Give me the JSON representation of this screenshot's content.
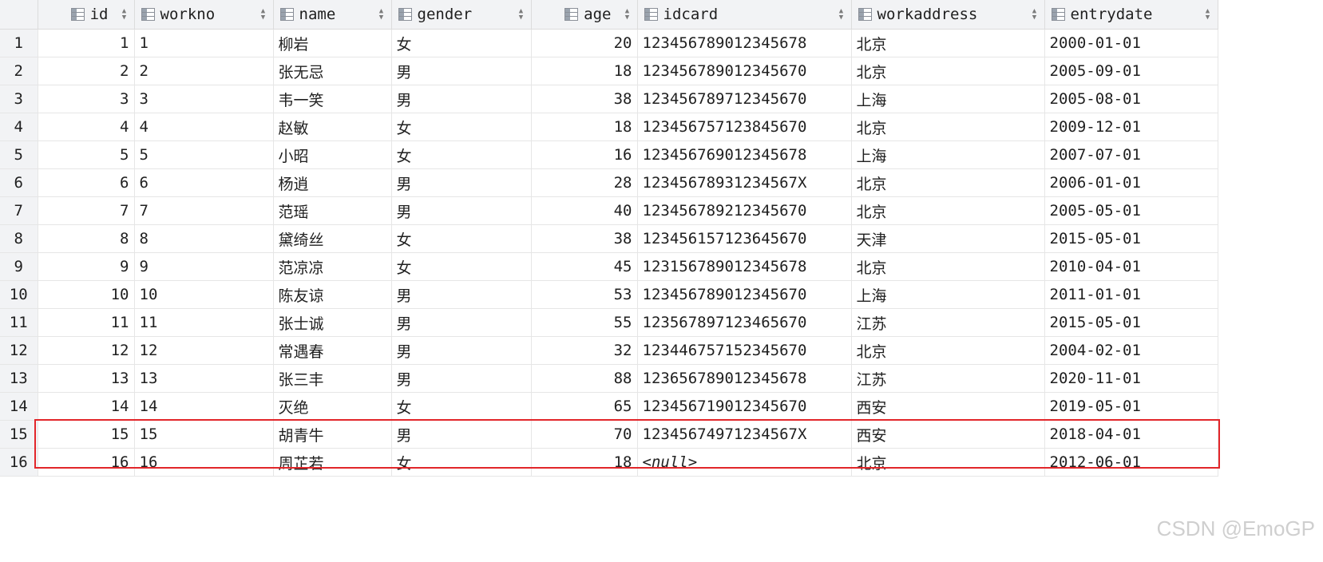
{
  "columns": [
    "id",
    "workno",
    "name",
    "gender",
    "age",
    "idcard",
    "workaddress",
    "entrydate"
  ],
  "rows": [
    {
      "n": "1",
      "id": "1",
      "workno": "1",
      "name": "柳岩",
      "gender": "女",
      "age": "20",
      "idcard": "123456789012345678",
      "workaddress": "北京",
      "entrydate": "2000-01-01"
    },
    {
      "n": "2",
      "id": "2",
      "workno": "2",
      "name": "张无忌",
      "gender": "男",
      "age": "18",
      "idcard": "123456789012345670",
      "workaddress": "北京",
      "entrydate": "2005-09-01"
    },
    {
      "n": "3",
      "id": "3",
      "workno": "3",
      "name": "韦一笑",
      "gender": "男",
      "age": "38",
      "idcard": "123456789712345670",
      "workaddress": "上海",
      "entrydate": "2005-08-01"
    },
    {
      "n": "4",
      "id": "4",
      "workno": "4",
      "name": "赵敏",
      "gender": "女",
      "age": "18",
      "idcard": "123456757123845670",
      "workaddress": "北京",
      "entrydate": "2009-12-01"
    },
    {
      "n": "5",
      "id": "5",
      "workno": "5",
      "name": "小昭",
      "gender": "女",
      "age": "16",
      "idcard": "123456769012345678",
      "workaddress": "上海",
      "entrydate": "2007-07-01"
    },
    {
      "n": "6",
      "id": "6",
      "workno": "6",
      "name": "杨逍",
      "gender": "男",
      "age": "28",
      "idcard": "12345678931234567X",
      "workaddress": "北京",
      "entrydate": "2006-01-01"
    },
    {
      "n": "7",
      "id": "7",
      "workno": "7",
      "name": "范瑶",
      "gender": "男",
      "age": "40",
      "idcard": "123456789212345670",
      "workaddress": "北京",
      "entrydate": "2005-05-01"
    },
    {
      "n": "8",
      "id": "8",
      "workno": "8",
      "name": "黛绮丝",
      "gender": "女",
      "age": "38",
      "idcard": "123456157123645670",
      "workaddress": "天津",
      "entrydate": "2015-05-01"
    },
    {
      "n": "9",
      "id": "9",
      "workno": "9",
      "name": "范凉凉",
      "gender": "女",
      "age": "45",
      "idcard": "123156789012345678",
      "workaddress": "北京",
      "entrydate": "2010-04-01"
    },
    {
      "n": "10",
      "id": "10",
      "workno": "10",
      "name": "陈友谅",
      "gender": "男",
      "age": "53",
      "idcard": "123456789012345670",
      "workaddress": "上海",
      "entrydate": "2011-01-01"
    },
    {
      "n": "11",
      "id": "11",
      "workno": "11",
      "name": "张士诚",
      "gender": "男",
      "age": "55",
      "idcard": "123567897123465670",
      "workaddress": "江苏",
      "entrydate": "2015-05-01"
    },
    {
      "n": "12",
      "id": "12",
      "workno": "12",
      "name": "常遇春",
      "gender": "男",
      "age": "32",
      "idcard": "123446757152345670",
      "workaddress": "北京",
      "entrydate": "2004-02-01"
    },
    {
      "n": "13",
      "id": "13",
      "workno": "13",
      "name": "张三丰",
      "gender": "男",
      "age": "88",
      "idcard": "123656789012345678",
      "workaddress": "江苏",
      "entrydate": "2020-11-01"
    },
    {
      "n": "14",
      "id": "14",
      "workno": "14",
      "name": "灭绝",
      "gender": "女",
      "age": "65",
      "idcard": "123456719012345670",
      "workaddress": "西安",
      "entrydate": "2019-05-01"
    },
    {
      "n": "15",
      "id": "15",
      "workno": "15",
      "name": "胡青牛",
      "gender": "男",
      "age": "70",
      "idcard": "12345674971234567X",
      "workaddress": "西安",
      "entrydate": "2018-04-01"
    },
    {
      "n": "16",
      "id": "16",
      "workno": "16",
      "name": "周芷若",
      "gender": "女",
      "age": "18",
      "idcard": "<null>",
      "workaddress": "北京",
      "entrydate": "2012-06-01"
    }
  ],
  "watermark": "CSDN @EmoGP",
  "icons": {
    "column": "table-column-icon",
    "sort": "sort-arrows-icon"
  },
  "colors": {
    "highlight_border": "#e2262a",
    "header_bg": "#f2f3f5"
  }
}
